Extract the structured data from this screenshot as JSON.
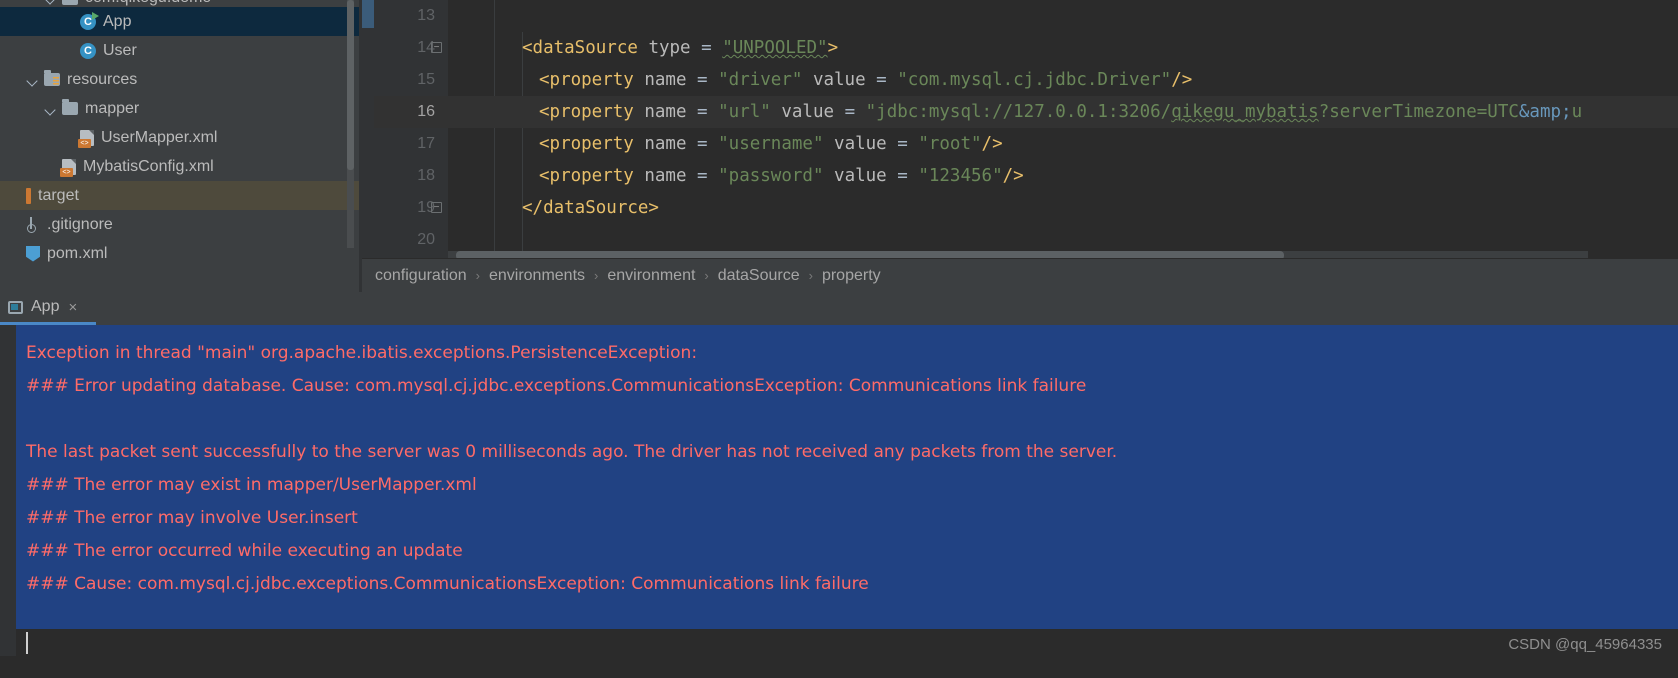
{
  "project_tree": {
    "items": [
      {
        "label": "com.qikegu.demo",
        "icon": "package-icon",
        "depth": 2,
        "state": "expanded",
        "partial": true
      },
      {
        "label": "App",
        "icon": "java-class-runnable-icon",
        "depth": 3,
        "state": "selected"
      },
      {
        "label": "User",
        "icon": "java-class-icon",
        "depth": 3,
        "state": "normal"
      },
      {
        "label": "resources",
        "icon": "resources-folder-icon",
        "depth": 1,
        "state": "expanded"
      },
      {
        "label": "mapper",
        "icon": "folder-icon",
        "depth": 2,
        "state": "expanded"
      },
      {
        "label": "UserMapper.xml",
        "icon": "xml-file-icon",
        "depth": 3,
        "state": "normal"
      },
      {
        "label": "MybatisConfig.xml",
        "icon": "xml-file-icon",
        "depth": 2,
        "state": "normal"
      },
      {
        "label": "target",
        "icon": "excluded-folder-icon",
        "depth": 0,
        "state": "highlighted"
      },
      {
        "label": ".gitignore",
        "icon": "git-file-icon",
        "depth": 0,
        "state": "normal"
      },
      {
        "label": "pom.xml",
        "icon": "maven-file-icon",
        "depth": 0,
        "state": "normal"
      }
    ]
  },
  "editor": {
    "lines": [
      {
        "number": "13",
        "current": false,
        "fold": false,
        "indent": 0,
        "tokens": []
      },
      {
        "number": "14",
        "current": false,
        "fold": true,
        "indent": 0,
        "tokens": [
          {
            "t": "<dataSource ",
            "c": "t-tag"
          },
          {
            "t": "type ",
            "c": "t-attr2"
          },
          {
            "t": "= ",
            "c": "t-eq"
          },
          {
            "t": "\"UNPOOLED\"",
            "c": "t-str squiggle"
          },
          {
            "t": ">",
            "c": "t-tag"
          }
        ]
      },
      {
        "number": "15",
        "current": false,
        "fold": false,
        "indent": 1,
        "tokens": [
          {
            "t": "<property ",
            "c": "t-tag"
          },
          {
            "t": "name ",
            "c": "t-attr2"
          },
          {
            "t": "= ",
            "c": "t-eq"
          },
          {
            "t": "\"driver\" ",
            "c": "t-str"
          },
          {
            "t": "value ",
            "c": "t-attr2"
          },
          {
            "t": "= ",
            "c": "t-eq"
          },
          {
            "t": "\"com.mysql.cj.jdbc.Driver\"",
            "c": "t-str"
          },
          {
            "t": "/>",
            "c": "t-tag"
          }
        ]
      },
      {
        "number": "16",
        "current": true,
        "fold": false,
        "indent": 1,
        "tokens": [
          {
            "t": "<property ",
            "c": "t-tag"
          },
          {
            "t": "name ",
            "c": "t-attr2"
          },
          {
            "t": "= ",
            "c": "t-eq"
          },
          {
            "t": "\"url\" ",
            "c": "t-str"
          },
          {
            "t": "value ",
            "c": "t-attr2"
          },
          {
            "t": "= ",
            "c": "t-eq"
          },
          {
            "t": "\"jdbc:mysql://127.0.0.1:3206/",
            "c": "t-str"
          },
          {
            "t": "qikegu_mybatis",
            "c": "t-str squiggle"
          },
          {
            "t": "?serverTimezone=UTC",
            "c": "t-str"
          },
          {
            "t": "&amp;",
            "c": "t-ent"
          },
          {
            "t": "u",
            "c": "t-str"
          }
        ]
      },
      {
        "number": "17",
        "current": false,
        "fold": false,
        "indent": 1,
        "tokens": [
          {
            "t": "<property ",
            "c": "t-tag"
          },
          {
            "t": "name ",
            "c": "t-attr2"
          },
          {
            "t": "= ",
            "c": "t-eq"
          },
          {
            "t": "\"username\" ",
            "c": "t-str"
          },
          {
            "t": "value ",
            "c": "t-attr2"
          },
          {
            "t": "= ",
            "c": "t-eq"
          },
          {
            "t": "\"root\"",
            "c": "t-str"
          },
          {
            "t": "/>",
            "c": "t-tag"
          }
        ]
      },
      {
        "number": "18",
        "current": false,
        "fold": false,
        "indent": 1,
        "tokens": [
          {
            "t": "<property ",
            "c": "t-tag"
          },
          {
            "t": "name ",
            "c": "t-attr2"
          },
          {
            "t": "= ",
            "c": "t-eq"
          },
          {
            "t": "\"password\" ",
            "c": "t-str"
          },
          {
            "t": "value ",
            "c": "t-attr2"
          },
          {
            "t": "= ",
            "c": "t-eq"
          },
          {
            "t": "\"123456\"",
            "c": "t-str"
          },
          {
            "t": "/>",
            "c": "t-tag"
          }
        ]
      },
      {
        "number": "19",
        "current": false,
        "fold": true,
        "indent": 0,
        "tokens": [
          {
            "t": "</dataSource>",
            "c": "t-tag"
          }
        ]
      },
      {
        "number": "20",
        "current": false,
        "fold": false,
        "indent": 0,
        "tokens": []
      }
    ],
    "breadcrumbs": [
      "configuration",
      "environments",
      "environment",
      "dataSource",
      "property"
    ],
    "breadcrumb_separator": "›"
  },
  "console": {
    "tab_label": "App",
    "tab_close_glyph": "×",
    "lines": [
      "Exception in thread \"main\" org.apache.ibatis.exceptions.PersistenceException:",
      "### Error updating database.  Cause: com.mysql.cj.jdbc.exceptions.CommunicationsException: Communications link failure",
      "",
      "The last packet sent successfully to the server was 0 milliseconds ago. The driver has not received any packets from the server.",
      "### The error may exist in mapper/UserMapper.xml",
      "### The error may involve User.insert",
      "### The error occurred while executing an update",
      "### Cause: com.mysql.cj.jdbc.exceptions.CommunicationsException: Communications link failure"
    ],
    "watermark": "CSDN @qq_45964335"
  },
  "colors": {
    "selection_blue": "#214283",
    "error_red": "#ff6b68",
    "tab_accent": "#4a88c7",
    "tree_selected": "#0d293e",
    "editor_bg": "#2b2b2b",
    "panel_bg": "#3c3f41",
    "string_green": "#6a8759",
    "tag_yellow": "#e8bf6a"
  }
}
